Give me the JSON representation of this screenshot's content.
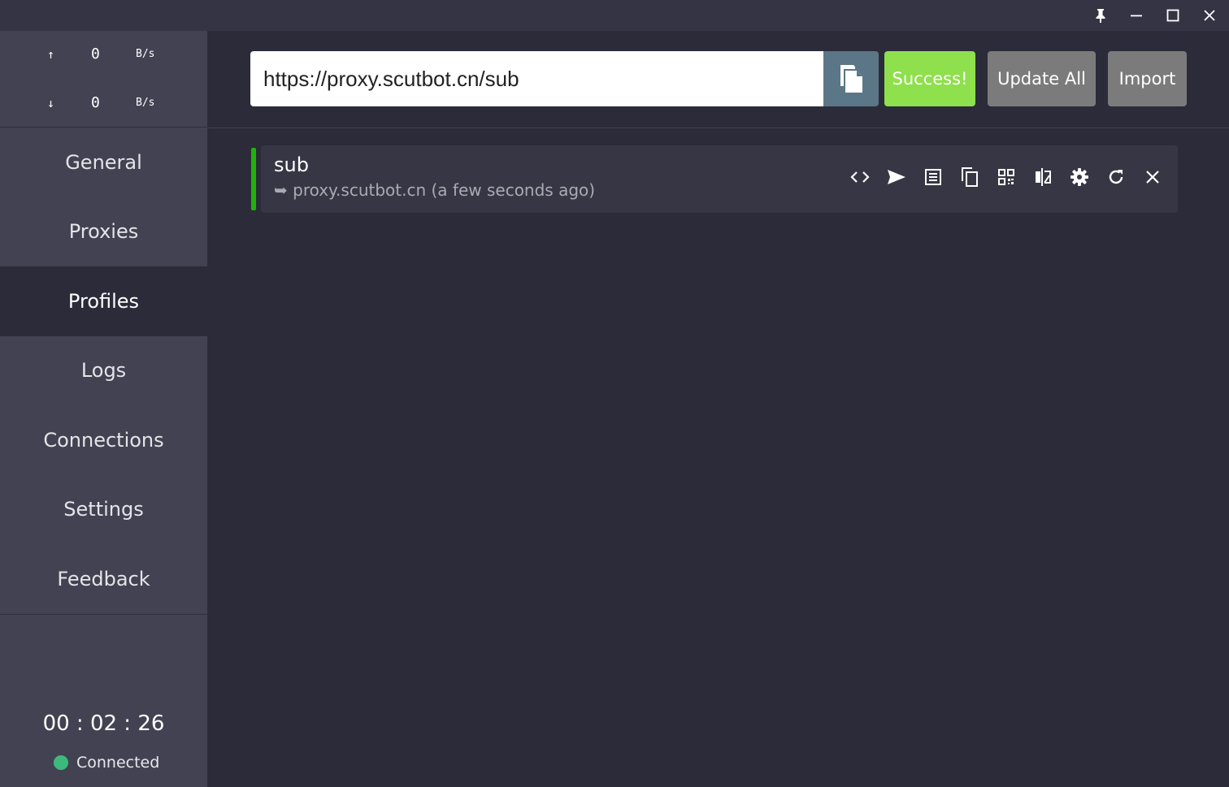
{
  "traffic": {
    "up_arrow": "↑",
    "up_value": "0",
    "up_unit": "B/s",
    "down_arrow": "↓",
    "down_value": "0",
    "down_unit": "B/s"
  },
  "nav": {
    "items": [
      {
        "label": "General"
      },
      {
        "label": "Proxies"
      },
      {
        "label": "Profiles"
      },
      {
        "label": "Logs"
      },
      {
        "label": "Connections"
      },
      {
        "label": "Settings"
      },
      {
        "label": "Feedback"
      }
    ],
    "active": "Profiles"
  },
  "timer": "00 : 02 : 26",
  "status": {
    "label": "Connected",
    "color": "#3cba7c"
  },
  "url_input": {
    "value": "https://proxy.scutbot.cn/sub"
  },
  "buttons": {
    "success": "Success!",
    "update_all": "Update All",
    "import": "Import"
  },
  "profile": {
    "name": "sub",
    "arrow": "➥",
    "source": "proxy.scutbot.cn (a few seconds ago)",
    "accent_color": "#1fb30a",
    "actions": [
      "code-icon",
      "send-icon",
      "list-icon",
      "copy-icon",
      "qr-code-icon",
      "compare-icon",
      "gear-icon",
      "refresh-icon",
      "close-icon"
    ]
  },
  "window_controls": [
    "pin-icon",
    "minimize-icon",
    "maximize-icon",
    "close-icon"
  ],
  "colors": {
    "background": "#2c2b3a",
    "sidebar": "#434253",
    "success": "#8ee04c",
    "neutral_button": "#7b7b7b",
    "paste_button": "#5b7687"
  }
}
